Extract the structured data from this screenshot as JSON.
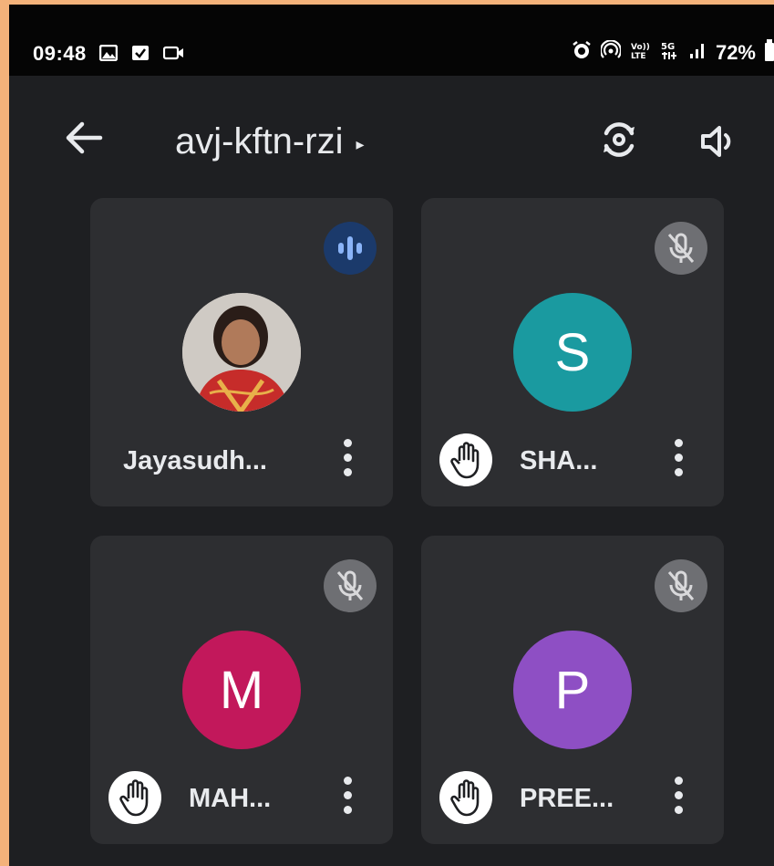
{
  "status_bar": {
    "time": "09:48",
    "battery": "72%",
    "icons": [
      "gallery-icon",
      "checkbox-icon",
      "video-icon",
      "alarm-icon",
      "hotspot-icon",
      "volte-icon",
      "5g-icon",
      "signal-icon",
      "battery-icon"
    ]
  },
  "app_bar": {
    "meeting_code": "avj-kftn-rzi",
    "caret": "▸",
    "icons": [
      "back-arrow-icon",
      "switch-camera-icon",
      "speaker-icon"
    ]
  },
  "participants": [
    {
      "name": "Jayasudh...",
      "avatar_type": "photo",
      "initial": "",
      "avatar_color": "#c9c4bf",
      "status": "speaking",
      "hand_raised": false
    },
    {
      "name": "SHA...",
      "avatar_type": "initial",
      "initial": "S",
      "avatar_color": "#1a9aa0",
      "status": "muted",
      "hand_raised": true
    },
    {
      "name": "MAH...",
      "avatar_type": "initial",
      "initial": "M",
      "avatar_color": "#c2185b",
      "status": "muted",
      "hand_raised": true
    },
    {
      "name": "PREE...",
      "avatar_type": "initial",
      "initial": "P",
      "avatar_color": "#8e4fc4",
      "status": "muted",
      "hand_raised": true
    }
  ],
  "colors": {
    "frame": "#f4b27a",
    "background": "#1e1f22",
    "tile": "#2d2e31",
    "speaking_badge": "#1b3a6b",
    "speaking_accent": "#8ab4f8",
    "muted_badge": "#6e6f73"
  }
}
